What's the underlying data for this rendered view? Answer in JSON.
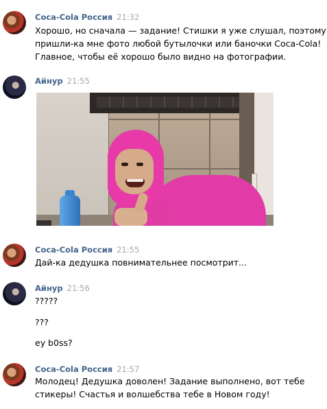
{
  "messages": [
    {
      "author": "Coca-Cola Россия",
      "time": "21:32",
      "lines": [
        "Хорошо, но сначала — задание! Стишки я уже слушал, поэтому",
        "пришли-ка мне фото любой бутылочки или баночки Coca-Cola!",
        "Главное, чтобы её хорошо было видно на фотографии."
      ]
    },
    {
      "author": "Айнур",
      "time": "21:55",
      "attachment": "photo-of-person-in-pink-suit"
    },
    {
      "author": "Coca-Cola Россия",
      "time": "21:55",
      "lines": [
        "Дай-ка дедушка повнимательнее посмотрит..."
      ]
    },
    {
      "author": "Айнур",
      "time": "21:56",
      "lines": [
        "?????",
        "???",
        "ey b0ss?"
      ]
    },
    {
      "author": "Coca-Cola Россия",
      "time": "21:57",
      "lines": [
        "Молодец! Дедушка доволен! Задание выполнено, вот тебе",
        "стикеры! Счастья и волшебства тебе в Новом году!"
      ]
    }
  ],
  "colors": {
    "author": "#42648b",
    "time": "#a0a8b4",
    "text": "#000000",
    "background": "#ffffff"
  }
}
